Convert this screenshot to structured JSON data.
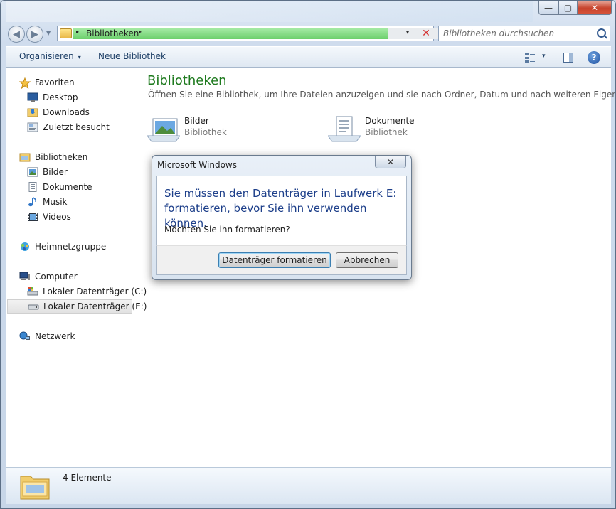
{
  "window": {
    "controls": {
      "minimize": "—",
      "maximize": "▢",
      "close": "✕"
    }
  },
  "addressbar": {
    "breadcrumb": "Bibliotheken",
    "arrow": "▸",
    "dropdown": "▾",
    "stop": "✕",
    "progress_percent": 82
  },
  "search": {
    "placeholder": "Bibliotheken durchsuchen"
  },
  "toolbar": {
    "organize": "Organisieren",
    "organize_drop": "▾",
    "new_library": "Neue Bibliothek",
    "view_drop": "▾",
    "help": "?"
  },
  "navigation": {
    "favorites": "Favoriten",
    "desktop": "Desktop",
    "downloads": "Downloads",
    "recent": "Zuletzt besucht",
    "libraries": "Bibliotheken",
    "pictures": "Bilder",
    "documents": "Dokumente",
    "music": "Musik",
    "videos": "Videos",
    "homegroup": "Heimnetzgruppe",
    "computer": "Computer",
    "drive_c": "Lokaler Datenträger (C:)",
    "drive_e": "Lokaler Datenträger (E:)",
    "network": "Netzwerk"
  },
  "main": {
    "title": "Bibliotheken",
    "subtitle": "Öffnen Sie eine Bibliothek, um Ihre Dateien anzuzeigen und sie nach Ordner, Datum und nach weiteren Eigenschafte...",
    "libraries": [
      {
        "name": "Bilder",
        "type": "Bibliothek"
      },
      {
        "name": "Dokumente",
        "type": "Bibliothek"
      }
    ]
  },
  "statusbar": {
    "count": "4 Elemente"
  },
  "dialog": {
    "title": "Microsoft Windows",
    "close": "✕",
    "message": "Sie müssen den Datenträger in Laufwerk E: formatieren, bevor Sie ihn verwenden können.",
    "question": "Möchten Sie ihn formatieren?",
    "primary_button": "Datenträger formatieren",
    "cancel_button": "Abbrechen"
  },
  "colors": {
    "title_green": "#1e7a1e",
    "dialog_message_blue": "#1d3f8a",
    "progress_green": "#6ccf6c",
    "close_red": "#c7432c"
  }
}
